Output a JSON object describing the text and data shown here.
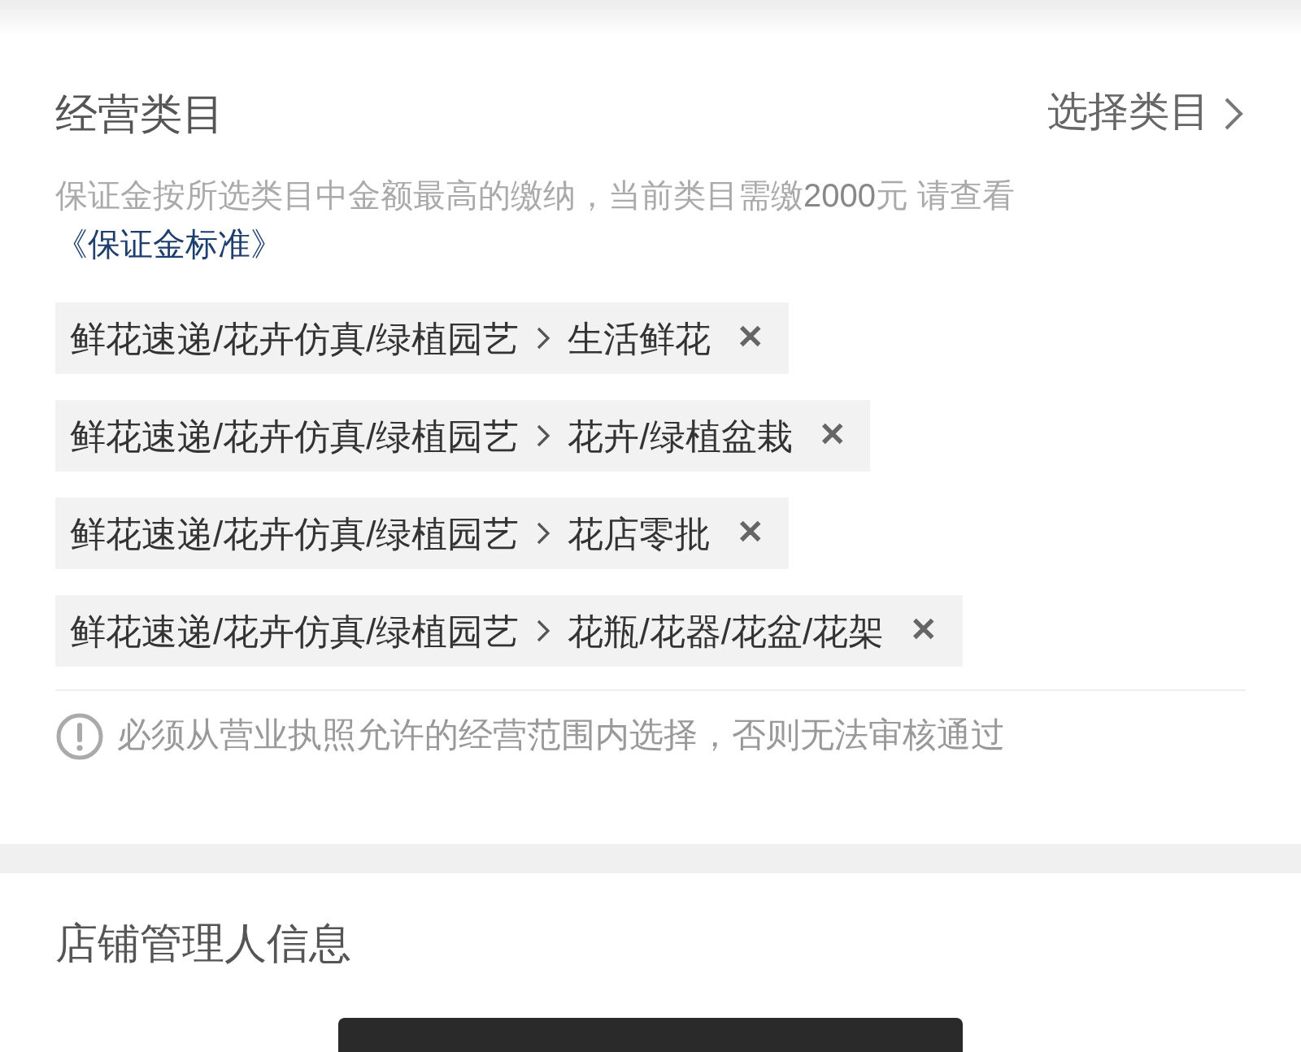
{
  "category_section": {
    "title": "经营类目",
    "select_link": "选择类目",
    "notice": "保证金按所选类目中金额最高的缴纳，当前类目需缴**2000**元 请查看",
    "standard_link": "《保证金标准》",
    "categories": [
      {
        "path": "鲜花速递/花卉仿真/绿植园艺",
        "leaf": "生活鲜花",
        "remove": "✕"
      },
      {
        "path": "鲜花速递/花卉仿真/绿植园艺",
        "leaf": "花卉/绿植盆栽",
        "remove": "✕"
      },
      {
        "path": "鲜花速递/花卉仿真/绿植园艺",
        "leaf": "花店零批",
        "remove": "✕"
      },
      {
        "path": "鲜花速递/花卉仿真/绿植园艺",
        "leaf": "花瓶/花器/花盆/花架",
        "remove": "✕"
      }
    ],
    "warning": "必须从营业执照允许的经营范围内选择，否则无法审核通过"
  },
  "manager_section": {
    "title": "店铺管理人信息"
  }
}
